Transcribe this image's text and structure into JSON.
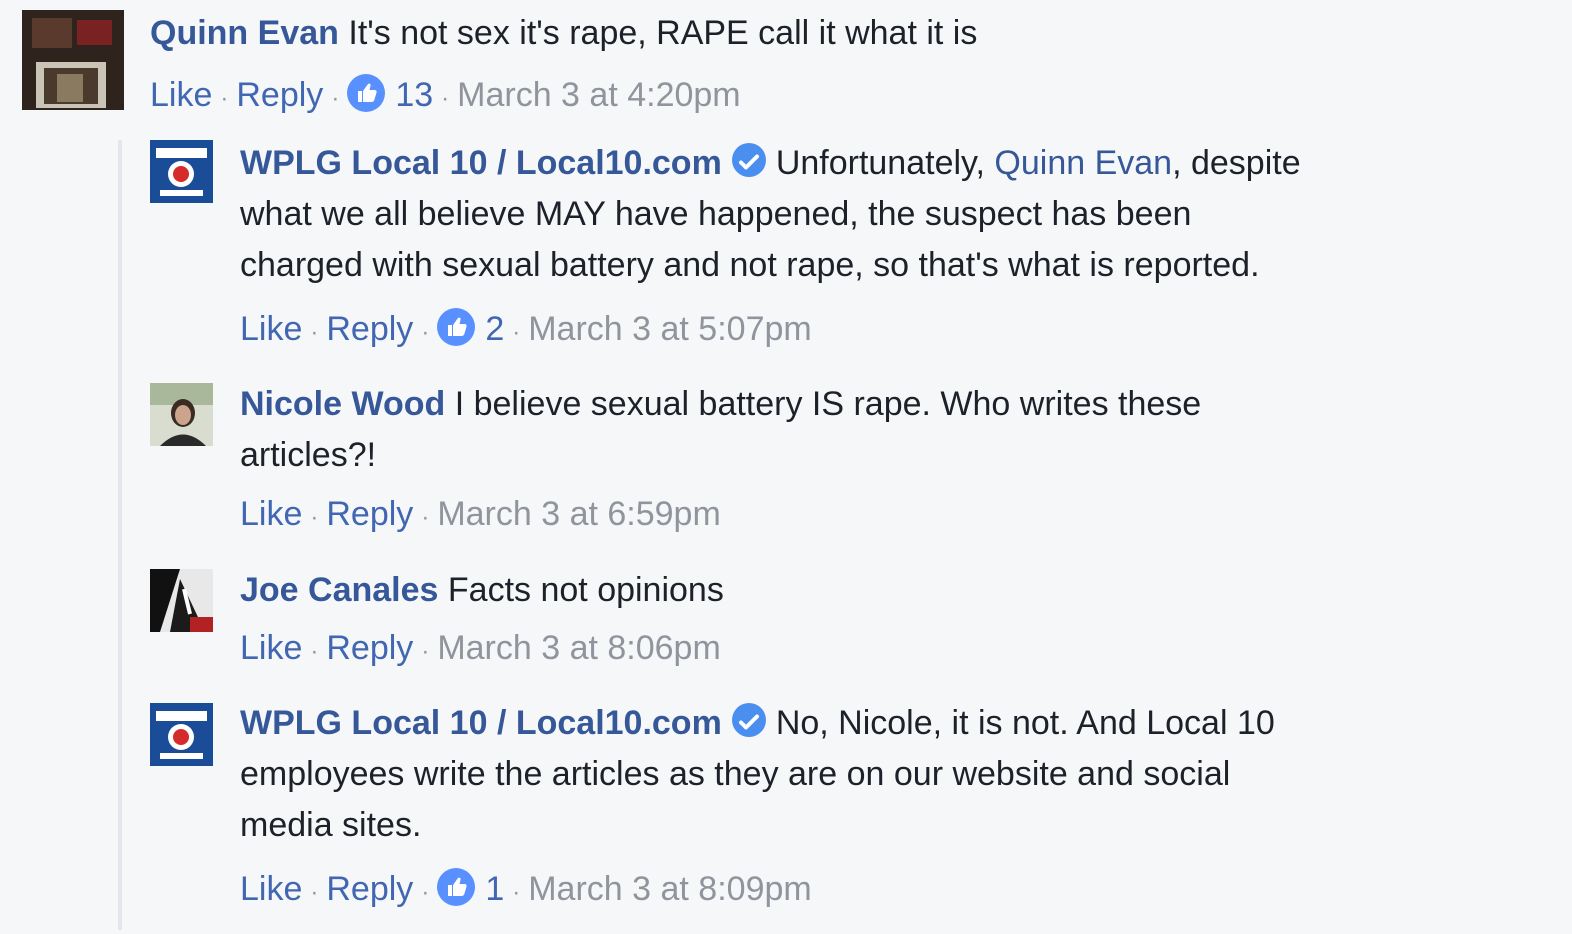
{
  "comments": [
    {
      "author": "Quinn Evan",
      "text": "It's not sex it's rape, RAPE call it what it is",
      "actions": {
        "like": "Like",
        "reply": "Reply"
      },
      "reactions": "13",
      "timestamp": "March 3 at 4:20pm"
    },
    {
      "author": "WPLG Local 10 / Local10.com",
      "mention": "Quinn Evan",
      "text_line1_pre": "Unfortunately, ",
      "text_line1_post": ", despite",
      "text_line2": "what we all believe MAY have happened, the suspect has been",
      "text_line3": "charged with sexual battery and not rape, so that's what is reported.",
      "actions": {
        "like": "Like",
        "reply": "Reply"
      },
      "reactions": "2",
      "timestamp": "March 3 at 5:07pm"
    },
    {
      "author": "Nicole Wood",
      "text_line1": "I believe sexual battery IS rape. Who writes these",
      "text_line2": "articles?!",
      "actions": {
        "like": "Like",
        "reply": "Reply"
      },
      "timestamp": "March 3 at 6:59pm"
    },
    {
      "author": "Joe Canales",
      "text": "Facts not opinions",
      "actions": {
        "like": "Like",
        "reply": "Reply"
      },
      "timestamp": "March 3 at 8:06pm"
    },
    {
      "author": "WPLG Local 10 / Local10.com",
      "text_line1": "No, Nicole, it is not. And Local 10",
      "text_line2": "employees write the articles as they are on our website and social",
      "text_line3": "media sites.",
      "actions": {
        "like": "Like",
        "reply": "Reply"
      },
      "reactions": "1",
      "timestamp": "March 3 at 8:09pm"
    }
  ],
  "colors": {
    "name": "#365899",
    "meta": "#90949c",
    "link": "#4267b2",
    "like_badge": "#5890ff",
    "verified": "#4a8ff0",
    "background": "#f6f7f9"
  },
  "icons": {
    "like": "thumbs-up-icon",
    "verified": "verified-badge-icon"
  }
}
